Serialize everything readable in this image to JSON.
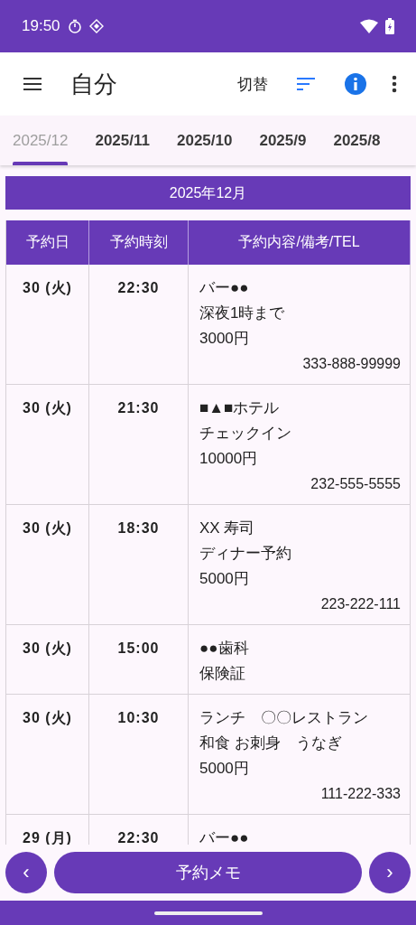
{
  "status_bar": {
    "time": "19:50"
  },
  "app_bar": {
    "title": "自分",
    "switch_label": "切替"
  },
  "tabs": [
    {
      "label": "2025/12",
      "selected": true
    },
    {
      "label": "2025/11",
      "selected": false
    },
    {
      "label": "2025/10",
      "selected": false
    },
    {
      "label": "2025/9",
      "selected": false
    },
    {
      "label": "2025/8",
      "selected": false
    }
  ],
  "month_header": "2025年12月",
  "table": {
    "columns": [
      "予約日",
      "予約時刻",
      "予約内容/備考/TEL"
    ],
    "rows": [
      {
        "date": "30 (火)",
        "time": "22:30",
        "lines": [
          "バー●●",
          "深夜1時まで",
          "3000円"
        ],
        "tel": "333-888-99999"
      },
      {
        "date": "30 (火)",
        "time": "21:30",
        "lines": [
          "■▲■ホテル",
          "チェックイン",
          "10000円"
        ],
        "tel": "232-555-5555"
      },
      {
        "date": "30 (火)",
        "time": "18:30",
        "lines": [
          "XX 寿司",
          "ディナー予約",
          "5000円"
        ],
        "tel": "223-222-111"
      },
      {
        "date": "30 (火)",
        "time": "15:00",
        "lines": [
          "●●歯科",
          "保険証"
        ]
      },
      {
        "date": "30 (火)",
        "time": "10:30",
        "lines": [
          "ランチ　〇〇レストラン",
          "和食 お刺身　うなぎ",
          "5000円"
        ],
        "tel": "111-222-333"
      },
      {
        "date": "29 (月)",
        "time": "22:30",
        "lines": [
          "バー●●"
        ]
      }
    ]
  },
  "bottom_bar": {
    "prev": "‹",
    "memo": "予約メモ",
    "next": "›"
  }
}
